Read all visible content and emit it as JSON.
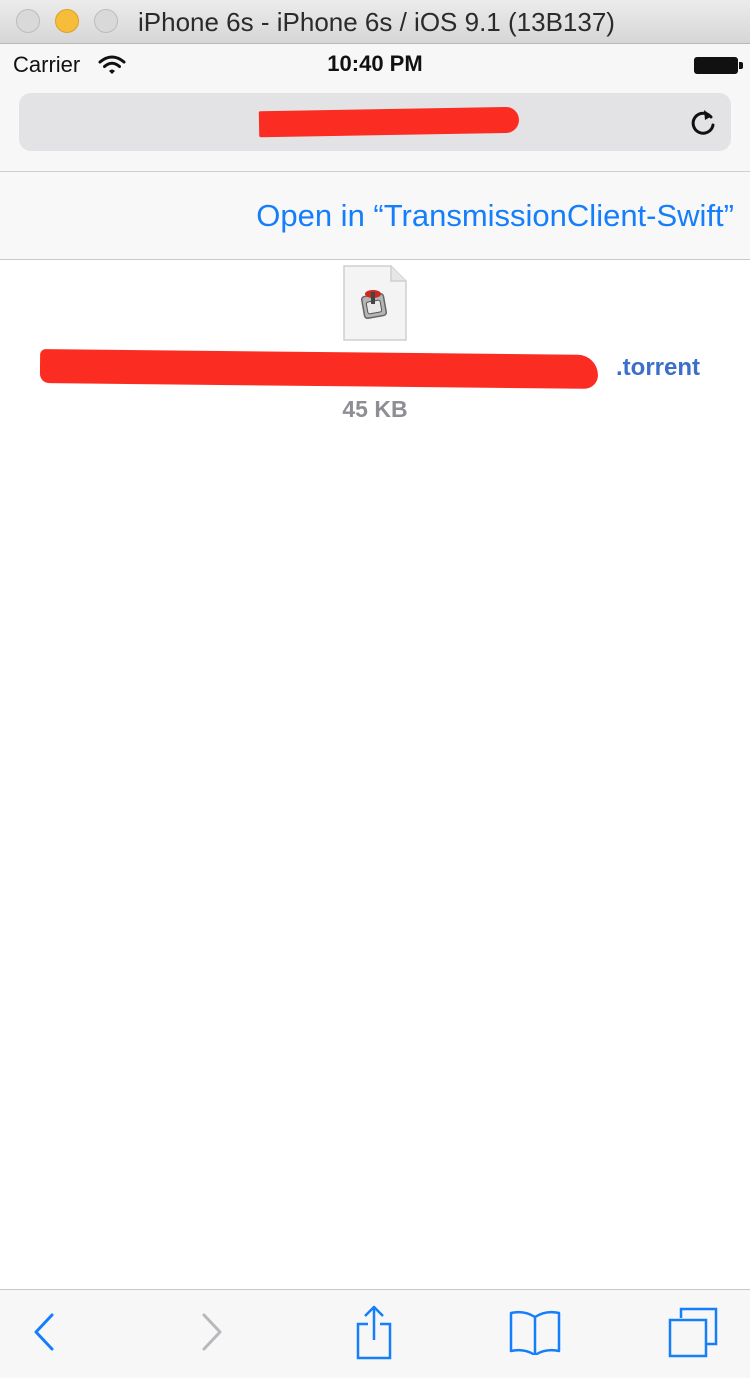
{
  "window": {
    "title": "iPhone 6s - iPhone 6s / iOS 9.1 (13B137)"
  },
  "status_bar": {
    "carrier": "Carrier",
    "time": "10:40 PM"
  },
  "address_bar": {
    "url": ""
  },
  "banner": {
    "open_in_label": "Open in “TransmissionClient-Swift”"
  },
  "file": {
    "name_visible": ".torrent",
    "size": "45 KB"
  },
  "colors": {
    "ios_blue": "#157efb",
    "link_blue": "#3b6fc9",
    "redaction": "#fb2c21",
    "muted_gray": "#8e8e93"
  },
  "toolbar": {
    "icons": [
      "back-icon",
      "forward-icon",
      "share-icon",
      "bookmarks-icon",
      "tabs-icon"
    ]
  }
}
